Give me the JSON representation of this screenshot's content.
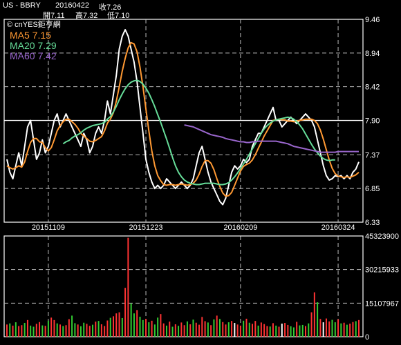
{
  "header": {
    "symbol": "US - BBRY",
    "date": "20160422",
    "close_label": "收7.26",
    "open_label": "開7.11",
    "high_label": "高7.32",
    "low_label": "低7.10"
  },
  "colors": {
    "price": "#ffffff",
    "ma5": "#ff9933",
    "ma20": "#66dd99",
    "ma60": "#9966cc",
    "vol_up": "#ff3333",
    "vol_down": "#33cc33",
    "grid": "#bbbbbb"
  },
  "chart_data": [
    {
      "type": "line",
      "watermark": "© cnYES鉅亨網",
      "legend": [
        {
          "key": "ma5",
          "label": "MA5 7.15"
        },
        {
          "key": "ma20",
          "label": "MA20 7.29"
        },
        {
          "key": "ma60",
          "label": "MA60 7.42"
        }
      ],
      "ylim": [
        6.33,
        9.46
      ],
      "y_ticks": [
        9.46,
        8.94,
        8.42,
        7.9,
        7.37,
        6.85,
        6.33
      ],
      "y_ref_line": 7.9,
      "n_points": 120,
      "x_ticks": [
        {
          "i": 14,
          "label": "20151109"
        },
        {
          "i": 47,
          "label": "20151223"
        },
        {
          "i": 79,
          "label": "20160209"
        },
        {
          "i": 112,
          "label": "20160324"
        }
      ],
      "series": [
        {
          "key": "price",
          "values": [
            7.3,
            7.1,
            7.0,
            7.2,
            7.4,
            7.2,
            7.5,
            7.8,
            7.9,
            7.6,
            7.3,
            7.4,
            7.6,
            7.4,
            7.5,
            7.7,
            7.9,
            8.0,
            7.8,
            7.9,
            8.0,
            7.9,
            7.8,
            7.7,
            7.6,
            7.5,
            7.7,
            7.6,
            7.4,
            7.5,
            7.7,
            7.8,
            7.7,
            7.9,
            8.2,
            8.0,
            8.3,
            8.6,
            9.0,
            9.2,
            9.3,
            9.2,
            9.0,
            8.8,
            8.5,
            8.1,
            7.7,
            7.3,
            7.1,
            6.95,
            6.85,
            6.9,
            6.85,
            6.9,
            7.0,
            6.95,
            6.9,
            6.85,
            6.9,
            6.95,
            6.9,
            6.85,
            6.9,
            7.0,
            7.2,
            7.4,
            7.5,
            7.3,
            7.1,
            6.95,
            6.85,
            6.75,
            6.65,
            6.6,
            6.7,
            6.9,
            7.1,
            7.2,
            7.15,
            7.2,
            7.3,
            7.25,
            7.3,
            7.5,
            7.6,
            7.7,
            7.7,
            7.8,
            7.9,
            8.0,
            8.1,
            7.9,
            7.9,
            7.8,
            7.85,
            7.9,
            7.95,
            7.9,
            7.85,
            7.9,
            7.95,
            8.0,
            7.95,
            7.9,
            7.8,
            7.6,
            7.4,
            7.2,
            7.05,
            6.98,
            7.0,
            7.05,
            7.03,
            7.05,
            7.0,
            7.05,
            7.0,
            7.1,
            7.15,
            7.26
          ]
        },
        {
          "key": "ma5",
          "values": [
            7.2,
            7.17,
            7.15,
            7.17,
            7.2,
            7.18,
            7.26,
            7.42,
            7.56,
            7.62,
            7.62,
            7.57,
            7.56,
            7.48,
            7.43,
            7.48,
            7.6,
            7.74,
            7.82,
            7.88,
            7.92,
            7.92,
            7.88,
            7.84,
            7.78,
            7.7,
            7.66,
            7.62,
            7.58,
            7.57,
            7.59,
            7.62,
            7.65,
            7.74,
            7.86,
            7.92,
            8.02,
            8.2,
            8.42,
            8.66,
            8.86,
            9.02,
            9.1,
            9.08,
            8.96,
            8.72,
            8.42,
            8.08,
            7.74,
            7.43,
            7.2,
            7.05,
            6.97,
            6.91,
            6.9,
            6.91,
            6.91,
            6.9,
            6.91,
            6.92,
            6.91,
            6.9,
            6.91,
            6.93,
            6.98,
            7.07,
            7.19,
            7.28,
            7.28,
            7.24,
            7.14,
            7.0,
            6.88,
            6.78,
            6.73,
            6.74,
            6.79,
            6.9,
            7.01,
            7.12,
            7.19,
            7.22,
            7.24,
            7.29,
            7.37,
            7.47,
            7.56,
            7.66,
            7.74,
            7.82,
            7.9,
            7.91,
            7.92,
            7.91,
            7.91,
            7.89,
            7.89,
            7.88,
            7.89,
            7.9,
            7.91,
            7.92,
            7.92,
            7.92,
            7.9,
            7.85,
            7.75,
            7.61,
            7.45,
            7.29,
            7.16,
            7.08,
            7.04,
            7.03,
            7.02,
            7.03,
            7.02,
            7.04,
            7.06,
            7.1
          ]
        },
        {
          "key": "ma20",
          "values": [
            null,
            null,
            null,
            null,
            null,
            null,
            null,
            null,
            null,
            null,
            null,
            null,
            null,
            null,
            null,
            null,
            null,
            null,
            null,
            7.54,
            7.57,
            7.59,
            7.63,
            7.66,
            7.68,
            7.71,
            7.75,
            7.78,
            7.8,
            7.82,
            7.83,
            7.84,
            7.85,
            7.87,
            7.92,
            7.96,
            8.03,
            8.12,
            8.22,
            8.31,
            8.39,
            8.45,
            8.49,
            8.51,
            8.52,
            8.5,
            8.46,
            8.4,
            8.32,
            8.22,
            8.11,
            7.99,
            7.87,
            7.74,
            7.61,
            7.47,
            7.33,
            7.2,
            7.1,
            7.03,
            6.98,
            6.95,
            6.93,
            6.92,
            6.91,
            6.91,
            6.92,
            6.93,
            6.93,
            6.93,
            6.93,
            6.92,
            6.91,
            6.91,
            6.92,
            6.94,
            6.98,
            7.03,
            7.09,
            7.16,
            7.23,
            7.3,
            7.38,
            7.46,
            7.54,
            7.62,
            7.7,
            7.77,
            7.82,
            7.86,
            7.89,
            7.91,
            7.92,
            7.93,
            7.94,
            7.95,
            7.94,
            7.92,
            7.88,
            7.83,
            7.77,
            7.69,
            7.61,
            7.53,
            7.46,
            7.4,
            7.35,
            7.31,
            7.29,
            7.28,
            7.29,
            7.29
          ]
        },
        {
          "key": "ma60",
          "values": [
            null,
            null,
            null,
            null,
            null,
            null,
            null,
            null,
            null,
            null,
            null,
            null,
            null,
            null,
            null,
            null,
            null,
            null,
            null,
            null,
            null,
            null,
            null,
            null,
            null,
            null,
            null,
            null,
            null,
            null,
            null,
            null,
            null,
            null,
            null,
            null,
            null,
            null,
            null,
            null,
            null,
            null,
            null,
            null,
            null,
            null,
            null,
            null,
            null,
            null,
            null,
            null,
            null,
            null,
            null,
            null,
            null,
            null,
            null,
            null,
            7.83,
            7.82,
            7.81,
            7.8,
            7.78,
            7.76,
            7.74,
            7.72,
            7.7,
            7.68,
            7.67,
            7.66,
            7.65,
            7.64,
            7.62,
            7.61,
            7.6,
            7.59,
            7.58,
            7.57,
            7.57,
            7.56,
            7.56,
            7.57,
            7.57,
            7.58,
            7.58,
            7.58,
            7.58,
            7.58,
            7.58,
            7.58,
            7.57,
            7.56,
            7.55,
            7.54,
            7.52,
            7.5,
            7.49,
            7.48,
            7.47,
            7.46,
            7.45,
            7.44,
            7.43,
            7.42,
            7.41,
            7.41,
            7.41,
            7.41,
            7.41,
            7.41,
            7.42,
            7.42,
            7.42,
            7.42,
            7.42,
            7.42,
            7.42,
            7.42
          ]
        }
      ]
    },
    {
      "type": "bar",
      "ylim": [
        0,
        45323900
      ],
      "y_ticks": [
        45323900,
        30215933,
        15107967,
        0
      ],
      "values": [
        5500000.0,
        6000000.0,
        5000000.0,
        6500000.0,
        4800000.0,
        5200000.0,
        6200000.0,
        7500000.0,
        5000000.0,
        4500000.0,
        5800000.0,
        6600000.0,
        5100000.0,
        4900000.0,
        7200000.0,
        8600000.0,
        7500000.0,
        6000000.0,
        5500000.0,
        4800000.0,
        5200000.0,
        7900000.0,
        9500000.0,
        6100000.0,
        5500000.0,
        4700000.0,
        6300000.0,
        5800000.0,
        4900000.0,
        5400000.0,
        6800000.0,
        7100000.0,
        5600000.0,
        4800000.0,
        7300000.0,
        8500000.0,
        9200000.0,
        10500000.0,
        11000000.0,
        8400000.0,
        22000000.0,
        44500000.0,
        15000000.0,
        10500000.0,
        12000000.0,
        9000000.0,
        7500000.0,
        8000000.0,
        6500000.0,
        7200000.0,
        5500000.0,
        8600000.0,
        10200000.0,
        6000000.0,
        5000000.0,
        6800000.0,
        4500000.0,
        5600000.0,
        4900000.0,
        6400000.0,
        5200000.0,
        6900000.0,
        5600000.0,
        7700000.0,
        6300000.0,
        5400000.0,
        8900000.0,
        7000000.0,
        6400000.0,
        5200000.0,
        7800000.0,
        9500000.0,
        8000000.0,
        6600000.0,
        5500000.0,
        6500000.0,
        7100000.0,
        6200000.0,
        5500000.0,
        5000000.0,
        7200000.0,
        8100000.0,
        6300000.0,
        5800000.0,
        7100000.0,
        5000000.0,
        6400000.0,
        5700000.0,
        4800000.0,
        4600000.0,
        6100000.0,
        5000000.0,
        4500000.0,
        5900000.0,
        6200000.0,
        5300000.0,
        4700000.0,
        4200000.0,
        6700000.0,
        5100000.0,
        5300000.0,
        4800000.0,
        6000000.0,
        11000000.0,
        20000000.0,
        15500000.0,
        8000000.0,
        6500000.0,
        8200000.0,
        6900000.0,
        7600000.0,
        6500000.0,
        7800000.0,
        6000000.0,
        6300000.0,
        5400000.0,
        5900000.0,
        6600000.0,
        7000000.0,
        7500000.0
      ],
      "up": [
        1,
        0,
        1,
        0,
        1,
        1,
        0,
        1,
        0,
        0,
        1,
        1,
        0,
        1,
        0,
        1,
        1,
        0,
        1,
        0,
        1,
        1,
        0,
        0,
        1,
        0,
        0,
        1,
        1,
        0,
        1,
        0,
        1,
        1,
        1,
        0,
        1,
        1,
        1,
        0,
        1,
        1,
        0,
        0,
        1,
        0,
        0,
        1,
        0,
        1,
        0,
        0,
        1,
        1,
        0,
        1,
        0,
        1,
        0,
        1,
        1,
        0,
        1,
        0,
        1,
        1,
        1,
        1,
        0,
        1,
        0,
        1,
        0,
        1,
        1,
        0,
        1,
        0,
        1,
        1,
        0,
        1,
        0,
        1,
        1,
        0,
        1,
        1,
        1,
        0,
        1,
        0,
        1,
        0,
        1,
        1,
        0,
        0,
        1,
        0,
        0,
        1,
        0,
        1,
        1,
        0,
        1,
        0,
        1,
        1,
        0,
        0,
        1,
        0,
        1,
        0,
        1,
        1,
        0,
        1
      ],
      "highlight": [
        {
          "i": 77,
          "color": "#ffffff"
        },
        {
          "i": 93,
          "color": "#ffffff"
        },
        {
          "i": 107,
          "color": "#ffffff"
        }
      ]
    }
  ]
}
